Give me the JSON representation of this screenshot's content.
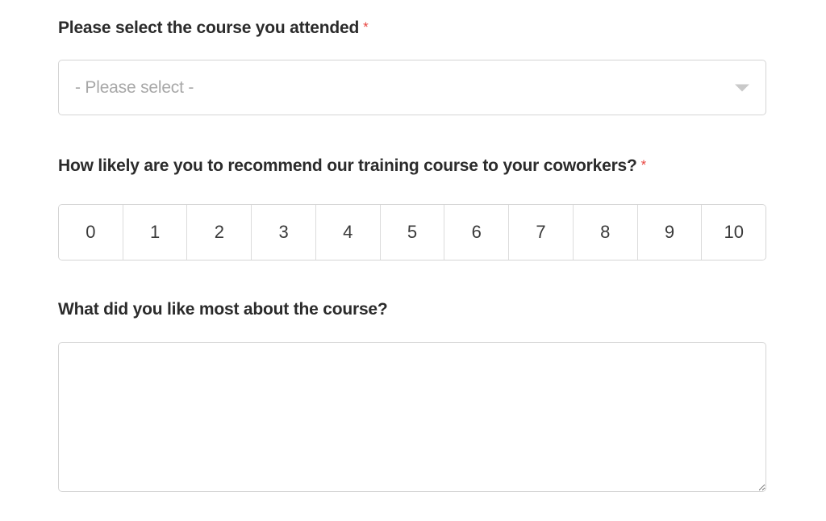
{
  "form": {
    "required_marker": "*",
    "accent_required_color": "#e8443f",
    "border_color": "#d4d4d4",
    "text_color": "#2b2b2b",
    "placeholder_color": "#a8a8a8",
    "fields": {
      "course": {
        "label": "Please select the course you attended",
        "required": true,
        "control_type": "select",
        "selected_value": "- Please select -",
        "dropdown_icon": "chevron-down-icon"
      },
      "recommend": {
        "label": "How likely are you to recommend our training course to your coworkers?",
        "required": true,
        "control_type": "scale",
        "options": [
          "0",
          "1",
          "2",
          "3",
          "4",
          "5",
          "6",
          "7",
          "8",
          "9",
          "10"
        ],
        "selected_value": ""
      },
      "liked_most": {
        "label": "What did you like most about the course?",
        "required": false,
        "control_type": "textarea",
        "value": "",
        "placeholder": "",
        "resize_handle_icon": "resize-grip-icon"
      }
    }
  }
}
